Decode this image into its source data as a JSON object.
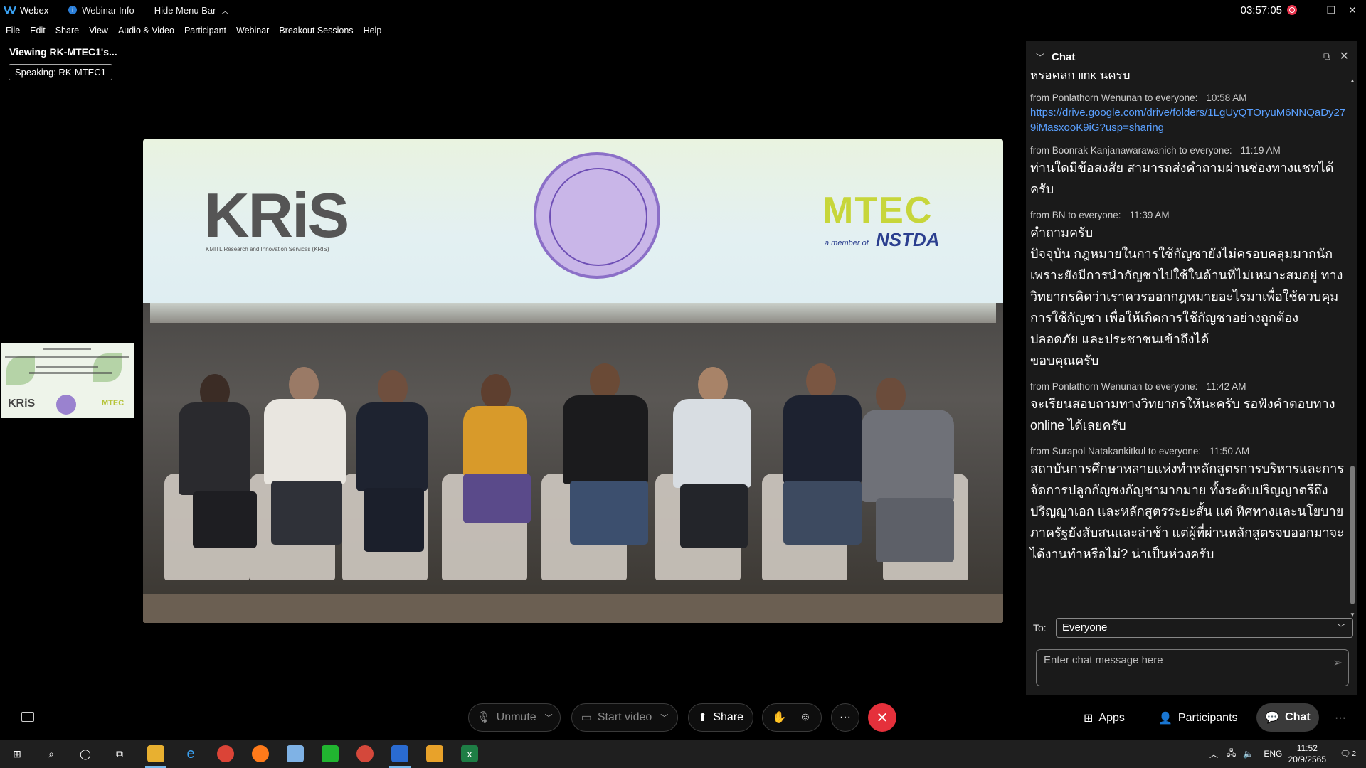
{
  "titlebar": {
    "app_name": "Webex",
    "webinar_info": "Webinar Info",
    "hide_menu": "Hide Menu Bar",
    "clock": "03:57:05"
  },
  "menu": [
    "File",
    "Edit",
    "Share",
    "View",
    "Audio & Video",
    "Participant",
    "Webinar",
    "Breakout Sessions",
    "Help"
  ],
  "left": {
    "viewing": "Viewing RK-MTEC1's...",
    "speaking": "Speaking: RK-MTEC1"
  },
  "slide": {
    "kris_logo": "KRiS",
    "kris_subtitle": "KMITL Research and Innovation Services (KRIS)",
    "mtec_logo": "MTEC",
    "member_of": "a member of",
    "nstda_logo": "NSTDA"
  },
  "chat": {
    "title": "Chat",
    "cut_text": "หรือคลิก link นี้ครับ",
    "messages": [
      {
        "from": "from Ponlathorn Wenunan to everyone:",
        "time": "10:58 AM",
        "link": "https://drive.google.com/drive/folders/1LgUyQTOryuM6NNQaDy279iMasxooK9iG?usp=sharing"
      },
      {
        "from": "from Boonrak Kanjanawarawanich to everyone:",
        "time": "11:19 AM",
        "text": "ท่านใดมีข้อสงสัย สามารถส่งคำถามผ่านช่องทางแชทได้ครับ"
      },
      {
        "from": "from BN to everyone:",
        "time": "11:39 AM",
        "text": "คำถามครับ\nปัจจุบัน กฎหมายในการใช้กัญชายังไม่ครอบคลุมมากนัก เพราะยังมีการนำกัญชาไปใช้ในด้านที่ไม่เหมาะสมอยู่ ทางวิทยากรคิดว่าเราควรออกกฎหมายอะไรมาเพื่อใช้ควบคุมการใช้กัญชา เพื่อให้เกิดการใช้กัญชาอย่างถูกต้อง ปลอดภัย และประชาชนเข้าถึงได้\nขอบคุณครับ"
      },
      {
        "from": "from Ponlathorn Wenunan to everyone:",
        "time": "11:42 AM",
        "text": "จะเรียนสอบถามทางวิทยากรให้นะครับ รอฟังคำตอบทาง online ได้เลยครับ"
      },
      {
        "from": "from Surapol Natakankitkul to everyone:",
        "time": "11:50 AM",
        "text": "สถาบันการศึกษาหลายแห่งทำหลักสูตรการบริหารและการจัดการปลูกกัญชงกัญชามากมาย ทั้งระดับปริญญาตรีถึงปริญญาเอก และหลักสูตรระยะสั้น แต่ ทิศทางและนโยบายภาครัฐยังสับสนและล่าช้า แต่ผู้ที่ผ่านหลักสูตรจบออกมาจะได้งานทำหรือไม่? น่าเป็นห่วงครับ"
      }
    ],
    "to_label": "To:",
    "to_value": "Everyone",
    "input_placeholder": "Enter chat message here"
  },
  "controls": {
    "unmute": "Unmute",
    "start_video": "Start video",
    "share": "Share",
    "apps": "Apps",
    "participants": "Participants",
    "chat": "Chat"
  },
  "taskbar": {
    "lang": "ENG",
    "time": "11:52",
    "date": "20/9/2565",
    "notif_count": "2"
  },
  "colors": {
    "end_call": "#e5303b",
    "link": "#5aa0ff",
    "record": "#e8364f"
  }
}
